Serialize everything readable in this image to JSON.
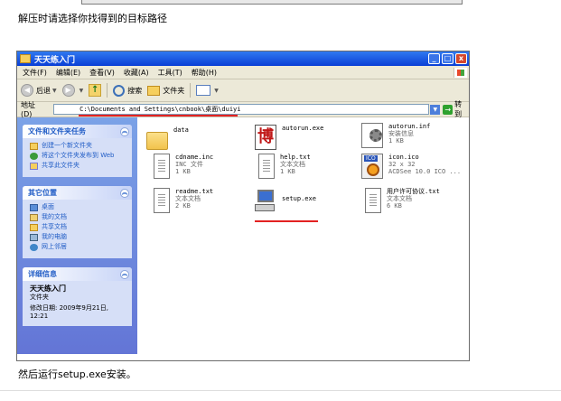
{
  "captions": {
    "top": "解压时请选择你找得到的目标路径",
    "bottom": "然后运行setup.exe安装。"
  },
  "window": {
    "title": "天天练入门",
    "controls": {
      "minimize": "_",
      "maximize": "□",
      "close": "x"
    }
  },
  "menu": [
    "文件(F)",
    "编辑(E)",
    "查看(V)",
    "收藏(A)",
    "工具(T)",
    "帮助(H)"
  ],
  "toolbar": {
    "back": "后退",
    "search": "搜索",
    "folders": "文件夹"
  },
  "address": {
    "label": "地址(D)",
    "value": "C:\\Documents and Settings\\cnbook\\桌面\\duiyi",
    "go": "转到"
  },
  "taskpane": {
    "file_tasks": {
      "title": "文件和文件夹任务",
      "items": [
        "创建一个新文件夹",
        "将这个文件夹发布到 Web",
        "共享此文件夹"
      ]
    },
    "other_places": {
      "title": "其它位置",
      "items": [
        "桌面",
        "我的文档",
        "共享文档",
        "我的电脑",
        "网上邻居"
      ]
    },
    "details": {
      "title": "详细信息",
      "name": "天天练入门",
      "type": "文件夹",
      "modified": "修改日期: 2009年9月21日, 12:21"
    }
  },
  "files": [
    {
      "name": "data",
      "type": "",
      "size": "",
      "icon": "folder-icon"
    },
    {
      "name": "autorun.exe",
      "type": "",
      "size": "",
      "icon": "app-icon"
    },
    {
      "name": "autorun.inf",
      "type": "安装信息",
      "size": "1 KB",
      "icon": "settings-file-icon"
    },
    {
      "name": "cdname.inc",
      "type": "INC 文件",
      "size": "1 KB",
      "icon": "document-icon"
    },
    {
      "name": "help.txt",
      "type": "文本文档",
      "size": "1 KB",
      "icon": "text-file-icon"
    },
    {
      "name": "icon.ico",
      "type": "32 x 32",
      "size": "ACDSee 10.0 ICO ...",
      "icon": "ico-file-icon"
    },
    {
      "name": "readme.txt",
      "type": "文本文档",
      "size": "2 KB",
      "icon": "text-file-icon"
    },
    {
      "name": "setup.exe",
      "type": "",
      "size": "",
      "icon": "setup-icon"
    },
    {
      "name": "用户许可协议.txt",
      "type": "文本文档",
      "size": "6 KB",
      "icon": "text-file-icon"
    }
  ],
  "colors": {
    "titlebar": "#0a3fd6",
    "taskpane": "#6375d6",
    "highlight_underline": "#e32222"
  }
}
